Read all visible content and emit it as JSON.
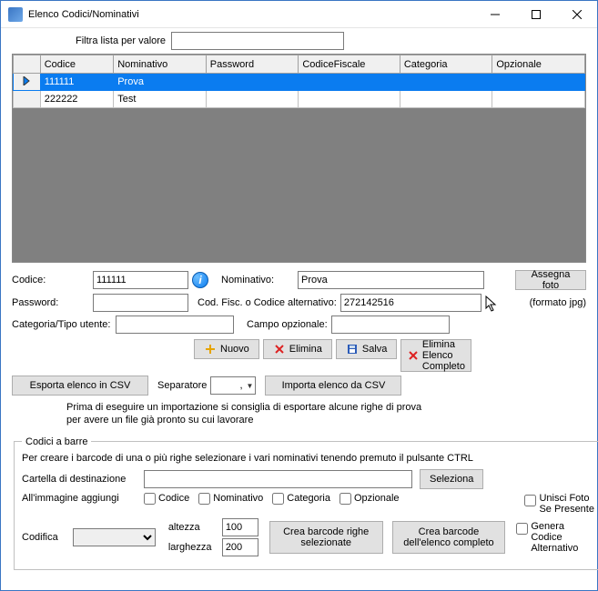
{
  "window": {
    "title": "Elenco Codici/Nominativi"
  },
  "filter": {
    "label": "Filtra lista per valore",
    "value": ""
  },
  "grid": {
    "headers": {
      "codice": "Codice",
      "nominativo": "Nominativo",
      "password": "Password",
      "codicefiscale": "CodiceFiscale",
      "categoria": "Categoria",
      "opzionale": "Opzionale"
    },
    "rows": [
      {
        "selected": true,
        "codice": "111111",
        "nominativo": "Prova",
        "password": "",
        "codicefiscale": "",
        "categoria": "",
        "opzionale": ""
      },
      {
        "selected": false,
        "codice": "222222",
        "nominativo": "Test",
        "password": "",
        "codicefiscale": "",
        "categoria": "",
        "opzionale": ""
      }
    ]
  },
  "form": {
    "codice_label": "Codice:",
    "codice_value": "111111",
    "nominativo_label": "Nominativo:",
    "nominativo_value": "Prova",
    "password_label": "Password:",
    "password_value": "",
    "codfisc_label": "Cod. Fisc. o Codice alternativo:",
    "codfisc_value": "272142516",
    "categoria_label": "Categoria/Tipo utente:",
    "categoria_value": "",
    "opzionale_label": "Campo opzionale:",
    "opzionale_value": "",
    "assegna_foto": "Assegna foto",
    "formato": "(formato jpg)"
  },
  "actions": {
    "nuovo": "Nuovo",
    "elimina": "Elimina",
    "salva": "Salva",
    "elimina_elenco": "Elimina\nElenco\nCompleto",
    "esporta": "Esporta elenco in CSV",
    "importa": "Importa elenco da CSV",
    "separatore_label": "Separatore",
    "separatore_value": ","
  },
  "note": "Prima di eseguire un importazione si consiglia di esportare alcune righe di prova per avere un file già pronto su cui lavorare",
  "barcode": {
    "legend": "Codici a barre",
    "intro": "Per creare i barcode di una o più righe selezionare i vari nominativi tenendo premuto il pulsante CTRL",
    "cartella_label": "Cartella di destinazione",
    "cartella_value": "",
    "seleziona": "Seleziona",
    "aggiungi_label": "All'immagine aggiungi",
    "chk_codice": "Codice",
    "chk_nominativo": "Nominativo",
    "chk_categoria": "Categoria",
    "chk_opzionale": "Opzionale",
    "unisci_foto": "Unisci Foto\nSe Presente",
    "codifica_label": "Codifica",
    "codifica_value": "",
    "altezza_label": "altezza",
    "altezza_value": "100",
    "larghezza_label": "larghezza",
    "larghezza_value": "200",
    "crea_sel": "Crea barcode righe\nselezionate",
    "crea_all": "Crea barcode\ndell'elenco completo",
    "genera_alt": "Genera Codice\nAlternativo"
  }
}
